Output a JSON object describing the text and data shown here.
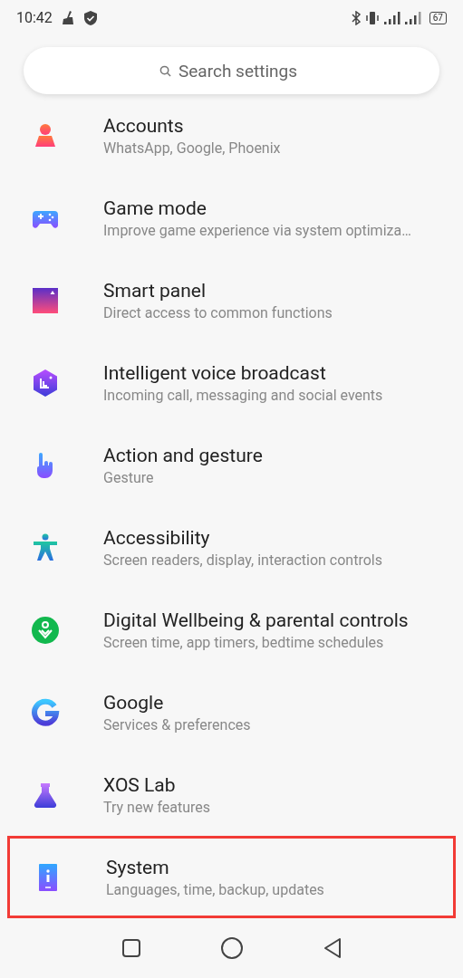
{
  "status_bar": {
    "time": "10:42",
    "battery": "67"
  },
  "search": {
    "placeholder": "Search settings"
  },
  "items": [
    {
      "kind": "person",
      "title": "Accounts",
      "subtitle": "WhatsApp, Google, Phoenix",
      "highlighted": false
    },
    {
      "kind": "gamepad",
      "title": "Game mode",
      "subtitle": "Improve game experience via system optimiza…",
      "highlighted": false
    },
    {
      "kind": "panel",
      "title": "Smart panel",
      "subtitle": "Direct access to common functions",
      "highlighted": false
    },
    {
      "kind": "voice",
      "title": "Intelligent voice broadcast",
      "subtitle": "Incoming call, messaging and social events",
      "highlighted": false
    },
    {
      "kind": "hand",
      "title": "Action and gesture",
      "subtitle": "Gesture",
      "highlighted": false
    },
    {
      "kind": "accessibility",
      "title": "Accessibility",
      "subtitle": "Screen readers, display, interaction controls",
      "highlighted": false
    },
    {
      "kind": "wellbeing",
      "title": "Digital Wellbeing & parental controls",
      "subtitle": "Screen time, app timers, bedtime schedules",
      "highlighted": false
    },
    {
      "kind": "google",
      "title": "Google",
      "subtitle": "Services & preferences",
      "highlighted": false
    },
    {
      "kind": "lab",
      "title": "XOS Lab",
      "subtitle": "Try new features",
      "highlighted": false
    },
    {
      "kind": "system",
      "title": "System",
      "subtitle": "Languages, time, backup, updates",
      "highlighted": true
    }
  ]
}
